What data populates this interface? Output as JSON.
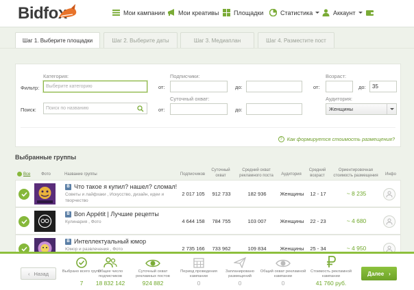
{
  "brand": {
    "name": "Bidfox"
  },
  "nav": [
    {
      "label": "Мои кампании",
      "icon": "menu-icon"
    },
    {
      "label": "Мои креативы",
      "icon": "megaphone-icon"
    },
    {
      "label": "Площадки",
      "icon": "grid-icon"
    },
    {
      "label": "Статистика",
      "icon": "pie-chart-icon",
      "dropdown": true
    },
    {
      "label": "Аккаунт",
      "icon": "user-icon",
      "dropdown": true
    },
    {
      "label": "",
      "icon": "wallet-icon"
    }
  ],
  "steps": [
    {
      "label": "Шаг 1. Выберите площадки",
      "active": true
    },
    {
      "label": "Шаг 2. Выберите даты",
      "active": false
    },
    {
      "label": "Шаг 3. Медиаплан",
      "active": false
    },
    {
      "label": "Шаг 4. Разместите пост",
      "active": false
    }
  ],
  "filters": {
    "filter_label": "Фильтр:",
    "search_label": "Поиск:",
    "category_label": "Категория:",
    "category_placeholder": "Выберите категорию",
    "search_placeholder": "Поиск по названию",
    "subscribers_label": "Подписчики:",
    "daily_reach_label": "Суточный охват:",
    "from": "от:",
    "to": "до:",
    "age_label": "Возраст:",
    "age_from": "",
    "age_to": "35",
    "audience_label": "Аудитория:",
    "audience_value": "Женщины",
    "how_link": "Как формируется стоимость размещения?"
  },
  "selected_title": "Выбранные группы",
  "table_headers": {
    "all": "Все",
    "photo": "Фото",
    "name": "Название группы",
    "subscribers": "Подписчиков",
    "daily_reach": "Суточный охват",
    "avg_reach": "Средний охват рекламного поста",
    "audience": "Аудитория",
    "avg_age": "Средний возраст",
    "price": "Ориентировочная стоимость размещения",
    "info": "Инфо"
  },
  "groups": [
    {
      "name": "Что такое я купил? нашел? сломал!",
      "category": "Советы и лайфхаки , Искусство, дизайн, идеи и творчество",
      "subscribers": "2 017 105",
      "daily_reach": "912 733",
      "avg_reach": "182 936",
      "audience": "Женщины",
      "age": "12 - 17",
      "price": "~ 8 235"
    },
    {
      "name": "Bon Appétit | Лучшие рецепты",
      "category": "Кулинария , Фото",
      "subscribers": "4 644 158",
      "daily_reach": "784 755",
      "avg_reach": "103 007",
      "audience": "Женщины",
      "age": "22 - 23",
      "price": "~ 4 680"
    },
    {
      "name": "Интеллектуальный юмор",
      "category": "Юмор и развлечения , Фото",
      "subscribers": "2 735 166",
      "daily_reach": "733 962",
      "avg_reach": "109 834",
      "audience": "Женщины",
      "age": "25 - 34",
      "price": "~ 4 950"
    }
  ],
  "footer": {
    "back": "Назад",
    "next": "Далее",
    "stats": [
      {
        "label": "Выбрано всего групп",
        "value": "7",
        "icon": "check-circle-icon",
        "active": true
      },
      {
        "label": "Общее число подписчиков",
        "value": "18 832 142",
        "icon": "users-icon",
        "active": true
      },
      {
        "label": "Суточный охват рекламных постов",
        "value": "924 882",
        "icon": "eye-icon",
        "active": true
      },
      {
        "label": "Период проведения кампании",
        "value": "0",
        "icon": "calendar-icon",
        "active": false
      },
      {
        "label": "Запланировано размещений",
        "value": "0",
        "icon": "paper-plane-icon",
        "active": false
      },
      {
        "label": "Общий охват рекламной кампании",
        "value": "0",
        "icon": "eye-icon",
        "active": false
      },
      {
        "label": "Стоимость рекламной кампании",
        "value": "41 760 руб.",
        "icon": "ruble-icon",
        "active": true
      }
    ]
  }
}
